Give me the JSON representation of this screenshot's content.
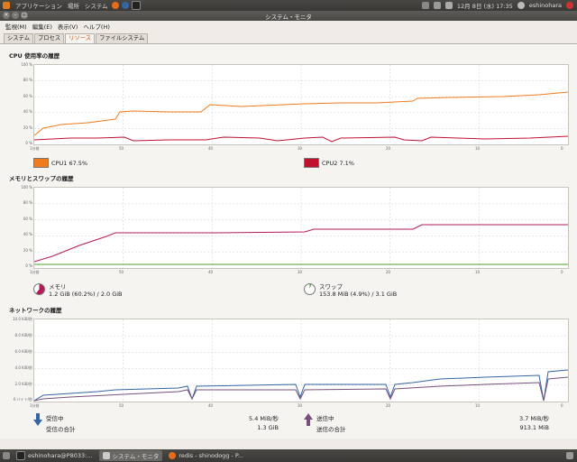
{
  "topbar": {
    "applications": "アプリケーション",
    "places": "場所",
    "system": "システム",
    "datetime": "12月 8日 (水) 17:35",
    "user": "eshinohara"
  },
  "window": {
    "title": "システム・モニタ"
  },
  "menu": [
    "監視(M)",
    "編集(E)",
    "表示(V)",
    "ヘルプ(H)"
  ],
  "tabs": [
    "システム",
    "プロセス",
    "リソース",
    "ファイルシステム"
  ],
  "active_tab": 2,
  "cpu": {
    "title": "CPU 使用率の履歴",
    "yticks": [
      "100 %",
      "80 %",
      "60 %",
      "40 %",
      "20 %",
      "0 %"
    ],
    "xticks": [
      "1分前",
      "50",
      "40",
      "30",
      "20",
      "10",
      "0"
    ],
    "cpu1_label": "CPU1",
    "cpu1_value": "67.5%",
    "cpu1_color": "#f07b1e",
    "cpu2_label": "CPU2",
    "cpu2_value": "7.1%",
    "cpu2_color": "#c0112f"
  },
  "mem": {
    "title": "メモリとスワップの履歴",
    "yticks": [
      "100 %",
      "80 %",
      "60 %",
      "40 %",
      "20 %",
      "0 %"
    ],
    "xticks": [
      "1分前",
      "50",
      "40",
      "30",
      "20",
      "10",
      "0"
    ],
    "mem_label": "メモリ",
    "mem_value": "1.2 GiB (60.2%) / 2.0 GiB",
    "mem_color": "#b5195a",
    "swap_label": "スワップ",
    "swap_value": "153.8 MiB (4.9%) / 3.1 GiB",
    "swap_color": "#4aa02c"
  },
  "net": {
    "title": "ネットワークの履歴",
    "yticks": [
      "10.0 KiB/秒",
      "8.0 KiB/秒",
      "6.0 KiB/秒",
      "4.0 KiB/秒",
      "2.0 KiB/秒",
      "0 バイト/秒"
    ],
    "xticks": [
      "1分前",
      "50",
      "40",
      "30",
      "20",
      "10",
      "0"
    ],
    "recv_label": "受信中",
    "recv_rate": "5.4 MiB/秒",
    "recv_total_label": "受信の合計",
    "recv_total": "1.3 GiB",
    "recv_color": "#3465a4",
    "send_label": "送信中",
    "send_rate": "3.7 MiB/秒",
    "send_total_label": "送信の合計",
    "send_total": "913.1 MiB",
    "send_color": "#75507b"
  },
  "taskbar": [
    "eshinohara@P8033:...",
    "システム・モニタ",
    "redis - shinodogg - P..."
  ]
}
